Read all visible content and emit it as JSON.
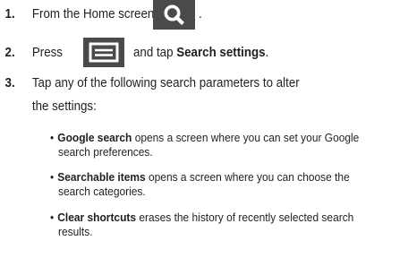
{
  "steps": [
    {
      "number": "1.",
      "text_before": "From the Home screen, tap",
      "text_after": "."
    },
    {
      "number": "2.",
      "text_before": "Press",
      "text_after_plain": "and tap",
      "text_after_bold": "Search settings",
      "text_end": "."
    },
    {
      "number": "3.",
      "line1": "Tap any of the following search parameters to alter",
      "line2": "the settings:"
    }
  ],
  "bullets": [
    {
      "term": "Google search",
      "line1": " opens a screen where you can set your Google",
      "line2": "search preferences."
    },
    {
      "term": "Searchable items",
      "line1": " opens a screen where you can choose the",
      "line2": "search categories."
    },
    {
      "term": "Clear shortcuts",
      "line1": " erases the history of recently selected search",
      "line2": "results."
    }
  ],
  "bullet_glyph": "•",
  "icons": {
    "search": "search-icon",
    "menu": "menu-icon"
  },
  "colors": {
    "text": "#231f20",
    "icon_bg": "#4a4a4a",
    "icon_fg": "#ffffff"
  }
}
